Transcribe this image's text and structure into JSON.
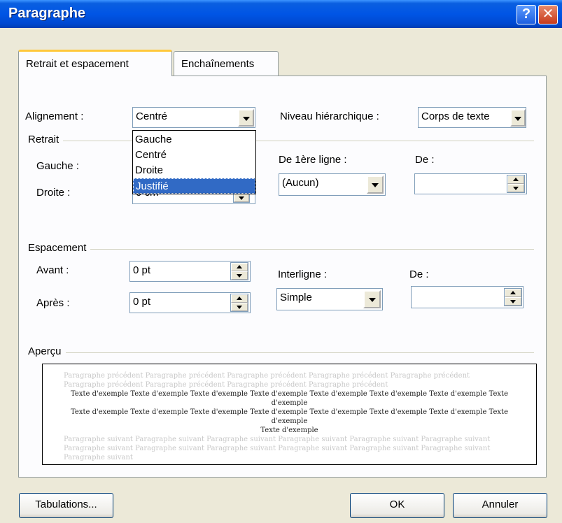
{
  "window": {
    "title": "Paragraphe",
    "help_glyph": "?",
    "close_glyph": "✕"
  },
  "tabs": [
    {
      "label": "Retrait et espacement",
      "active": true
    },
    {
      "label": "Enchaînements",
      "active": false
    }
  ],
  "general": {
    "alignment_label": "Alignement :",
    "alignment_value": "Centré",
    "level_label": "Niveau hiérarchique :",
    "level_value": "Corps de texte"
  },
  "alignment_options": [
    "Gauche",
    "Centré",
    "Droite",
    "Justifié"
  ],
  "alignment_highlighted": "Justifié",
  "retrait": {
    "group": "Retrait",
    "left_label": "Gauche :",
    "right_label": "Droite :",
    "right_value_partial": "0 cm",
    "first_line_label": "De 1ère ligne :",
    "first_line_value": "(Aucun)",
    "by_label": "De :",
    "by_value": ""
  },
  "espacement": {
    "group": "Espacement",
    "before_label": "Avant :",
    "before_value": "0 pt",
    "after_label": "Après :",
    "after_value": "0 pt",
    "line_label": "Interligne :",
    "line_value": "Simple",
    "at_label": "De :",
    "at_value": ""
  },
  "apercu": {
    "group": "Aperçu",
    "prev_line1": "Paragraphe précédent Paragraphe précédent Paragraphe précédent Paragraphe précédent Paragraphe précédent",
    "prev_line2": "Paragraphe précédent Paragraphe précédent Paragraphe précédent Paragraphe précédent",
    "sample_line1": "Texte d'exemple Texte d'exemple Texte d'exemple Texte d'exemple Texte d'exemple Texte d'exemple Texte d'exemple Texte d'exemple",
    "sample_line2": "Texte d'exemple Texte d'exemple Texte d'exemple Texte d'exemple Texte d'exemple Texte d'exemple Texte d'exemple Texte d'exemple",
    "sample_line3": "Texte d'exemple",
    "next_line1": "Paragraphe suivant Paragraphe suivant Paragraphe suivant Paragraphe suivant Paragraphe suivant Paragraphe suivant",
    "next_line2": "Paragraphe suivant Paragraphe suivant Paragraphe suivant Paragraphe suivant Paragraphe suivant Paragraphe suivant",
    "next_line3": "Paragraphe suivant"
  },
  "buttons": {
    "tabs_label": "Tabulations...",
    "ok_label": "OK",
    "cancel_label": "Annuler"
  },
  "colors": {
    "titlebar": "#0055E5",
    "selection": "#316AC5",
    "dialog_bg": "#ECE9D8"
  }
}
